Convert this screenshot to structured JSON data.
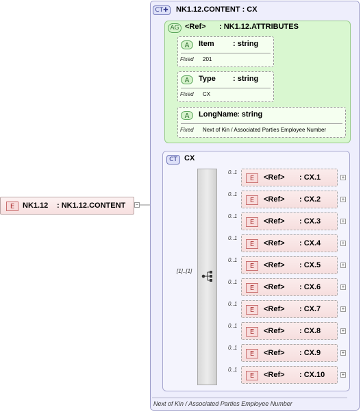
{
  "root": {
    "badge": "E",
    "name": "NK1.12",
    "type": ": NK1.12.CONTENT",
    "expander": "−"
  },
  "content_type": {
    "badge": "CT",
    "name": "NK1.12.CONTENT : CX"
  },
  "attribute_group": {
    "badge": "AG",
    "ref": "<Ref>",
    "type": ": NK1.12.ATTRIBUTES"
  },
  "attributes": [
    {
      "badge": "A",
      "name": "Item",
      "type": ": string",
      "fixed_label": "Fixed",
      "fixed_value": "201"
    },
    {
      "badge": "A",
      "name": "Type",
      "type": ": string",
      "fixed_label": "Fixed",
      "fixed_value": "CX"
    },
    {
      "badge": "A",
      "name": "LongName",
      "type": ": string",
      "fixed_label": "Fixed",
      "fixed_value": "Next of Kin / Associated Parties Employee Number"
    }
  ],
  "cx_type": {
    "badge": "CT",
    "name": "CX"
  },
  "sequence_occurrence": "[1]..[1]",
  "children": [
    {
      "badge": "E",
      "ref": "<Ref>",
      "type": ": CX.1",
      "occurrence": "0..1"
    },
    {
      "badge": "E",
      "ref": "<Ref>",
      "type": ": CX.2",
      "occurrence": "0..1"
    },
    {
      "badge": "E",
      "ref": "<Ref>",
      "type": ": CX.3",
      "occurrence": "0..1"
    },
    {
      "badge": "E",
      "ref": "<Ref>",
      "type": ": CX.4",
      "occurrence": "0..1"
    },
    {
      "badge": "E",
      "ref": "<Ref>",
      "type": ": CX.5",
      "occurrence": "0..1"
    },
    {
      "badge": "E",
      "ref": "<Ref>",
      "type": ": CX.6",
      "occurrence": "0..1"
    },
    {
      "badge": "E",
      "ref": "<Ref>",
      "type": ": CX.7",
      "occurrence": "0..1"
    },
    {
      "badge": "E",
      "ref": "<Ref>",
      "type": ": CX.8",
      "occurrence": "0..1"
    },
    {
      "badge": "E",
      "ref": "<Ref>",
      "type": ": CX.9",
      "occurrence": "0..1"
    },
    {
      "badge": "E",
      "ref": "<Ref>",
      "type": ": CX.10",
      "occurrence": "0..1"
    }
  ],
  "expand_symbol": "+",
  "documentation": "Next of Kin / Associated Parties Employee Number"
}
